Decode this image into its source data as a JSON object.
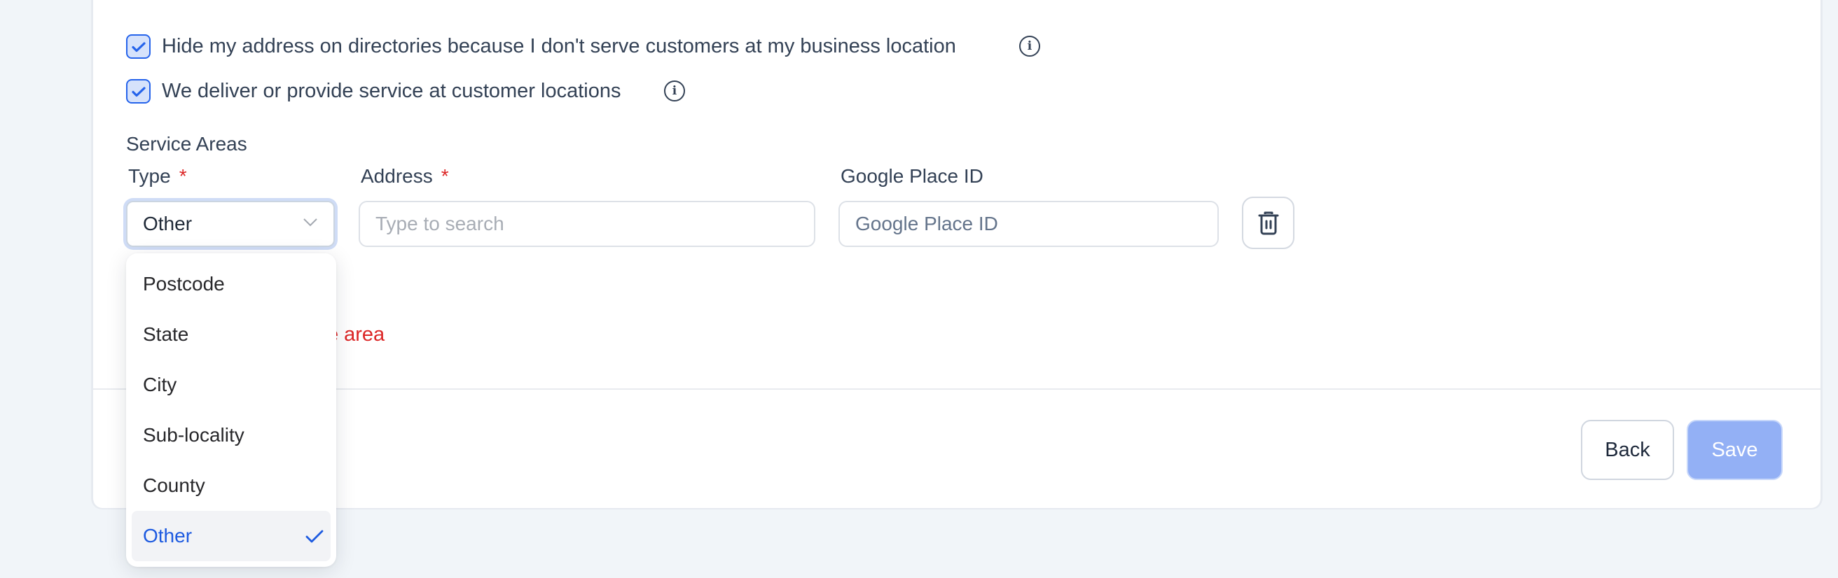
{
  "options": {
    "hide_address": {
      "label": "Hide my address on directories because I don't serve customers at my business location",
      "checked": true,
      "icon": "info-icon"
    },
    "deliver_service": {
      "label": "We deliver or provide service at customer locations",
      "checked": true,
      "icon": "info-icon"
    }
  },
  "service_areas": {
    "title": "Service Areas",
    "columns": {
      "type": {
        "label": "Type",
        "required_mark": "*"
      },
      "address": {
        "label": "Address",
        "required_mark": "*"
      },
      "place_id": {
        "label": "Google Place ID"
      }
    },
    "row": {
      "type_value": "Other",
      "address_value": "",
      "address_placeholder": "Type to search",
      "place_id_value": "",
      "place_id_placeholder": "Google Place ID",
      "delete_icon": "trash-icon"
    },
    "error_text_visible": "ice area",
    "type_dropdown": {
      "open": true,
      "options": [
        "Postcode",
        "State",
        "City",
        "Sub-locality",
        "County",
        "Other"
      ],
      "selected": "Other"
    }
  },
  "footer": {
    "back_label": "Back",
    "save_label": "Save",
    "save_disabled": true
  },
  "colors": {
    "accent": "#2563eb",
    "error": "#dc2626",
    "save_disabled_bg": "#93b0f5",
    "page_bg": "#f1f5f9"
  }
}
